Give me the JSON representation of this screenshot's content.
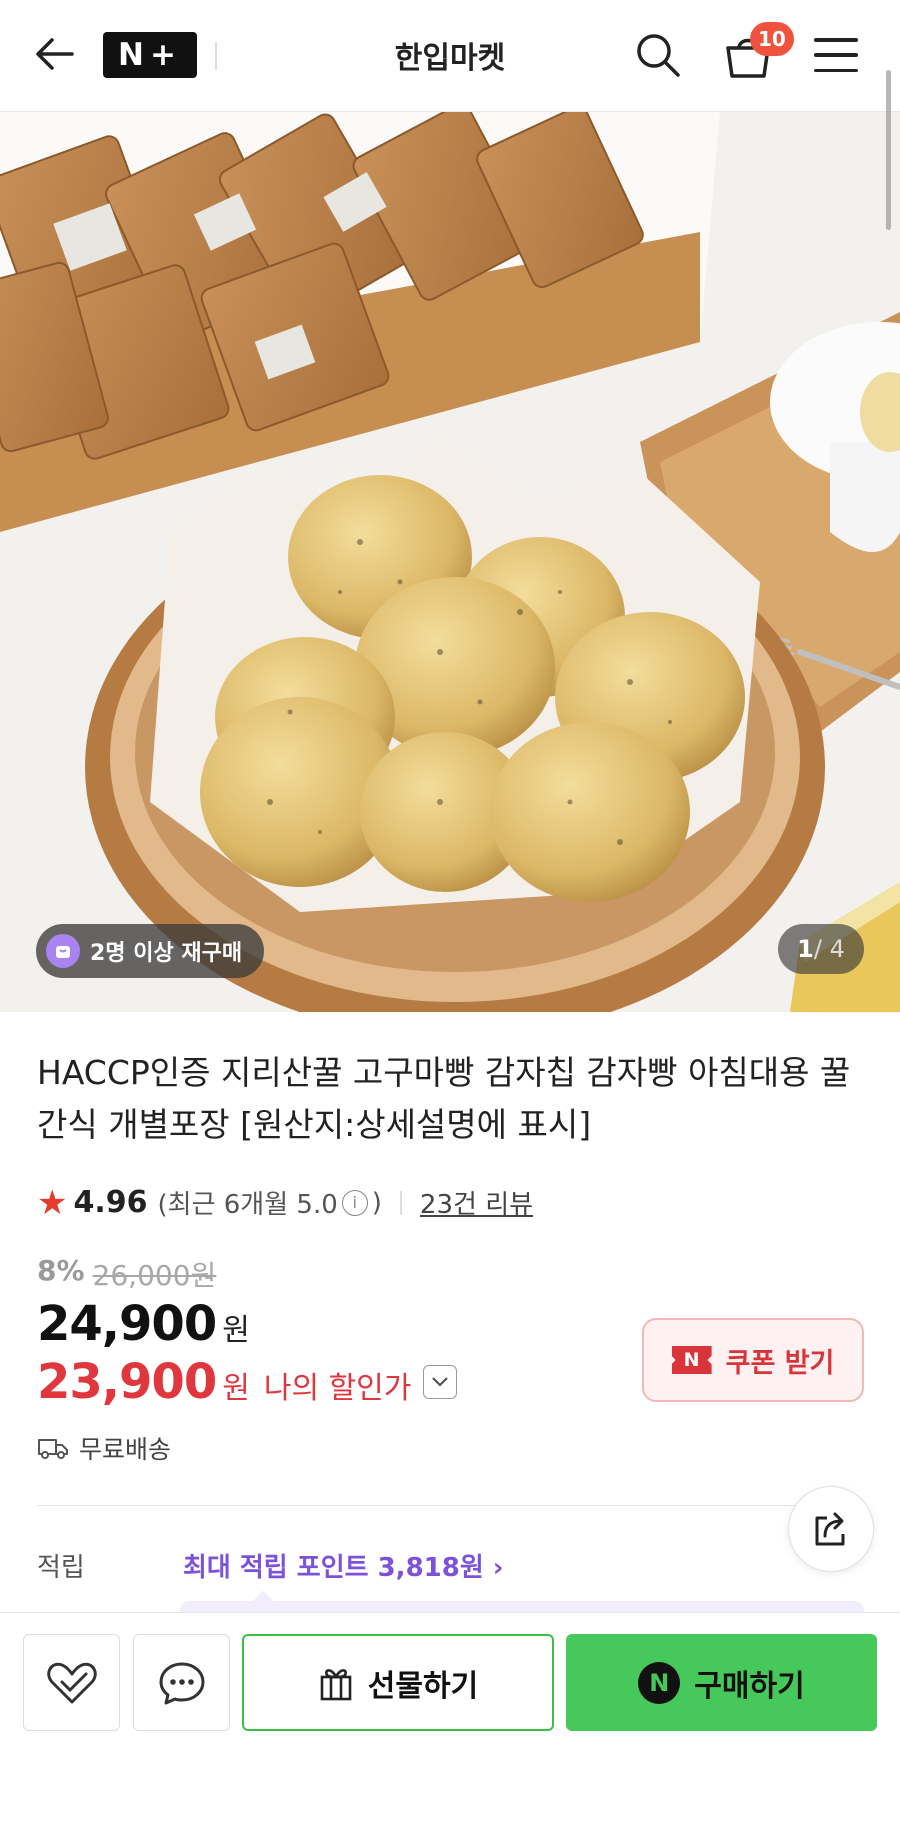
{
  "header": {
    "brand_logo_text": "N+",
    "store_name": "한입마켓",
    "cart_count": "10"
  },
  "gallery": {
    "repurchase_badge": "2명 이상 재구매",
    "current_image": "1",
    "total_images": "/ 4"
  },
  "product": {
    "title": "HACCP인증 지리산꿀 고구마빵 감자칩 감자빵 아침대용 꿀 간식 개별포장 [원산지:상세설명에 표시]",
    "rating": "4.96",
    "rating_recent_prefix": "(최근 6개월 5.0",
    "rating_recent_suffix": ")",
    "review_link": "23건 리뷰",
    "discount_rate": "8%",
    "original_price": "26,000원",
    "price": "24,900",
    "price_unit": "원",
    "my_price": "23,900",
    "my_price_unit": "원",
    "my_price_label": "나의 할인가",
    "coupon_label": "쿠폰 받기",
    "shipping": "무료배송",
    "points_label": "적립",
    "points_value": "최대 적립 포인트 3,818원 ›"
  },
  "actions": {
    "gift_label": "선물하기",
    "buy_label": "구매하기"
  },
  "icons": {
    "back": "back-arrow-icon",
    "search": "search-icon",
    "cart": "cart-icon",
    "menu": "hamburger-menu-icon",
    "share": "share-icon",
    "wish": "heart-icon",
    "talk": "chat-icon",
    "gift": "gift-icon",
    "truck": "truck-icon"
  },
  "colors": {
    "sale_red": "#e0363d",
    "naver_green": "#46c95a",
    "points_purple": "#7b52d9",
    "badge_orange": "#f0533d"
  }
}
